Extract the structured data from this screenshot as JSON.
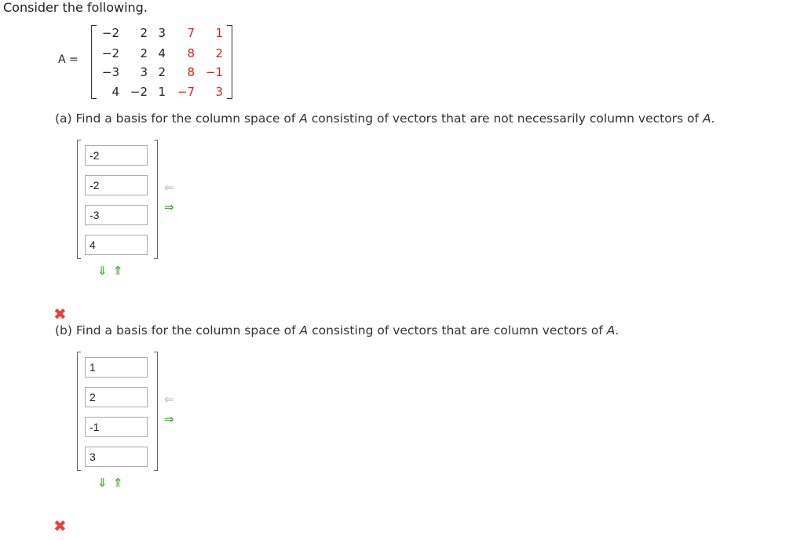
{
  "intro": "Consider the following.",
  "matrix_label": "A =",
  "matrix": [
    [
      "−2",
      "2",
      "3",
      "7",
      "1"
    ],
    [
      "−2",
      "2",
      "4",
      "8",
      "2"
    ],
    [
      "−3",
      "3",
      "2",
      "8",
      "−1"
    ],
    [
      "4",
      "−2",
      "1",
      "−7",
      "3"
    ]
  ],
  "red_columns": [
    3,
    4
  ],
  "part_a": {
    "question_pre": "(a) Find a basis for the column space of ",
    "question_var": "A",
    "question_post": " consisting of vectors that are not necessarily column vectors of ",
    "question_var2": "A",
    "question_end": ".",
    "inputs": [
      "-2",
      "-2",
      "-3",
      "4"
    ],
    "result_icon": "cross-icon"
  },
  "part_b": {
    "question_pre": "(b) Find a basis for the column space of ",
    "question_var": "A",
    "question_post": " consisting of vectors that are column vectors of ",
    "question_var2": "A",
    "question_end": ".",
    "inputs": [
      "1",
      "2",
      "-1",
      "3"
    ],
    "result_icon": "cross-icon"
  },
  "icons": {
    "remove_column": "arrow-left-icon",
    "add_column": "arrow-right-icon",
    "add_row": "arrow-down-icon",
    "remove_row": "arrow-up-icon",
    "wrong": "✖"
  },
  "colors": {
    "red_entry": "#e0201b",
    "grey_arrow": "#c8c8c8",
    "green_arrow": "#4caf3c",
    "cross": "#e8413b"
  }
}
